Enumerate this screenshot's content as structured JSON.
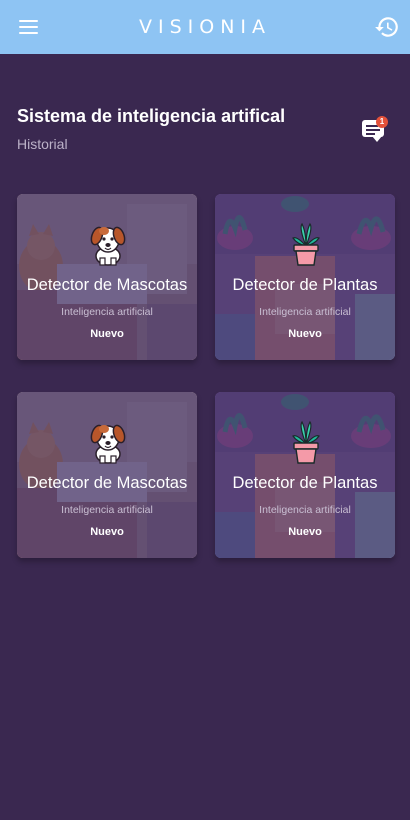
{
  "app": {
    "title": "VISIONIA",
    "menu_icon": "hamburger-menu-icon",
    "history_icon": "history-icon"
  },
  "section": {
    "title": "Sistema de inteligencia artifical",
    "subtitle": "Historial",
    "notification_count": "1",
    "notification_icon": "chat-notification-icon"
  },
  "cards": [
    {
      "title": "Detector de Mascotas",
      "subtitle": "Inteligencia artificial",
      "badge": "Nuevo",
      "icon": "dog-icon"
    },
    {
      "title": "Detector de Plantas",
      "subtitle": "Inteligencia artificial",
      "badge": "Nuevo",
      "icon": "potted-plant-icon"
    },
    {
      "title": "Detector de Mascotas",
      "subtitle": "Inteligencia artificial",
      "badge": "Nuevo",
      "icon": "dog-icon"
    },
    {
      "title": "Detector de Plantas",
      "subtitle": "Inteligencia artificial",
      "badge": "Nuevo",
      "icon": "potted-plant-icon"
    }
  ],
  "colors": {
    "app_bar": "#8ec4f3",
    "background": "#3a2850",
    "card_overlay": "#4a3868",
    "badge": "#e4523a"
  }
}
